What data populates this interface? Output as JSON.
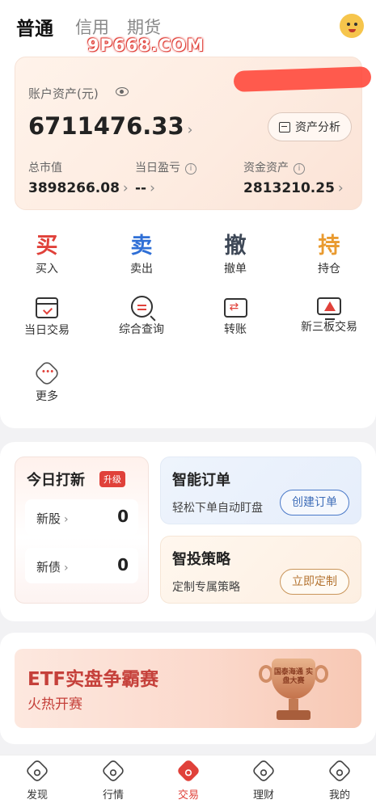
{
  "header": {
    "tabs": [
      {
        "label": "普通",
        "active": true
      },
      {
        "label": "信用",
        "active": false
      },
      {
        "label": "期货",
        "active": false
      }
    ],
    "watermark": "9P668.COM",
    "avatar_icon": "cat-avatar-icon"
  },
  "assets": {
    "label": "账户资产(元)",
    "total": "6711476.33",
    "analysis_button": "资产分析",
    "stats": [
      {
        "label": "总市值",
        "value": "3898266.08",
        "info": false
      },
      {
        "label": "当日盈亏",
        "value": "--",
        "info": true
      },
      {
        "label": "资金资产",
        "value": "2813210.25",
        "info": true
      }
    ]
  },
  "actions": [
    {
      "glyph": "买",
      "label": "买入",
      "color": "#e0413a"
    },
    {
      "glyph": "卖",
      "label": "卖出",
      "color": "#2f6fd6"
    },
    {
      "glyph": "撤",
      "label": "撤单",
      "color": "#3d4756"
    },
    {
      "glyph": "持",
      "label": "持仓",
      "color": "#e99a2f"
    }
  ],
  "tools": [
    {
      "label": "当日交易",
      "icon": "calendar-check-icon"
    },
    {
      "label": "综合查询",
      "icon": "search-icon"
    },
    {
      "label": "转账",
      "icon": "transfer-icon"
    },
    {
      "label": "新三板交易",
      "icon": "screen-chart-icon"
    },
    {
      "label": "更多",
      "icon": "more-icon"
    }
  ],
  "ipo": {
    "title": "今日打新",
    "badge": "升级",
    "rows": [
      {
        "label": "新股",
        "count": "0"
      },
      {
        "label": "新债",
        "count": "0"
      }
    ]
  },
  "promos": [
    {
      "title": "智能订单",
      "subtitle": "轻松下单自动盯盘",
      "button": "创建订单"
    },
    {
      "title": "智投策略",
      "subtitle": "定制专属策略",
      "button": "立即定制"
    }
  ],
  "banner": {
    "title": "ETF实盘争霸赛",
    "subtitle": "火热开赛",
    "trophy_text": "国泰海通 实盘大赛"
  },
  "bottom_nav": [
    {
      "label": "发现",
      "active": false
    },
    {
      "label": "行情",
      "active": false
    },
    {
      "label": "交易",
      "active": true
    },
    {
      "label": "理财",
      "active": false
    },
    {
      "label": "我的",
      "active": false
    }
  ],
  "colors": {
    "accent": "#e0413a",
    "buy": "#e0413a",
    "sell": "#2f6fd6",
    "cancel": "#3d4756",
    "hold": "#e99a2f"
  }
}
